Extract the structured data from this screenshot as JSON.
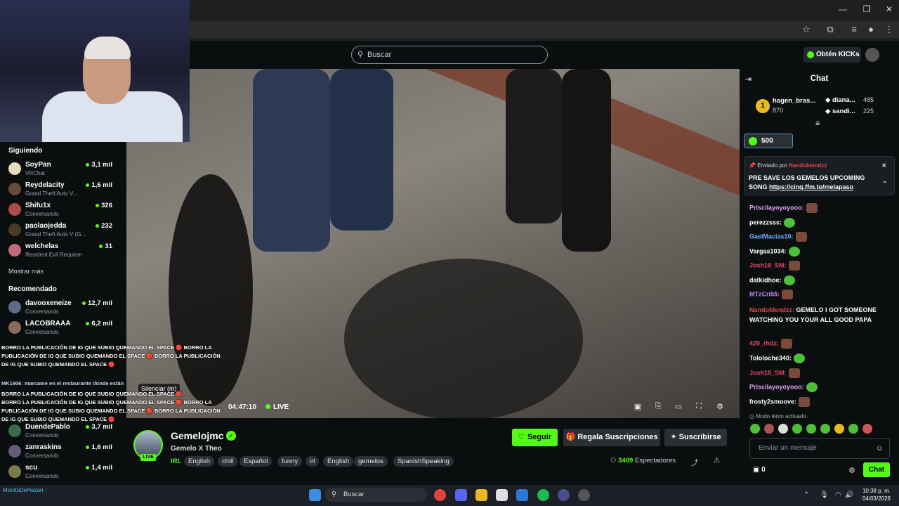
{
  "search": {
    "placeholder": "Buscar"
  },
  "header": {
    "kicks_label": "Obtén KICKs"
  },
  "sidebar": {
    "following_title": "Siguiendo",
    "following": [
      {
        "name": "SoyPan",
        "category": "VRChat",
        "viewers": "3,1 mil"
      },
      {
        "name": "Reydelacity",
        "category": "Grand Theft Auto V...",
        "viewers": "1,6 mil"
      },
      {
        "name": "Shifu1x",
        "category": "Conversando",
        "viewers": "326"
      },
      {
        "name": "paolaojedda",
        "category": "Grand Theft Auto V (G...",
        "viewers": "232"
      },
      {
        "name": "welchelas",
        "category": "Resident Evil Requiem",
        "viewers": "31"
      }
    ],
    "show_more": "Mostrar más",
    "recommended_title": "Recomendado",
    "recommended": [
      {
        "name": "davooxeneize",
        "category": "Conversando",
        "viewers": "12,7 mil"
      },
      {
        "name": "LACOBRAAA",
        "category": "Conversando",
        "viewers": "6,2 mil"
      },
      {
        "name": "DuendePablo",
        "category": "Conversando",
        "viewers": "3,7 mil"
      },
      {
        "name": "zanraskins",
        "category": "Conversando",
        "viewers": "1,6 mil"
      },
      {
        "name": "scu",
        "category": "Conversando",
        "viewers": "1,4 mil"
      }
    ]
  },
  "overlay_chat": {
    "lines": [
      "BORRO LA PUBLICACIÓN DE IG QUE SUBIO QUEMANDO EL SPACE 🔴 BORRO LA",
      "PUBLICACIÓN DE IG QUE SUBIO QUEMANDO EL SPACE 🔴 BORRO LA PUBLICACIÓN",
      "DE IG QUE SUBIO QUEMANDO EL SPACE 🔴",
      "MK1906: marcame en el restaurante donde están",
      "BORRO LA PUBLICACIÓN DE IG QUE SUBIO QUEMANDO EL SPACE 🔴",
      "BORRO LA PUBLICACIÓN DE IG QUE SUBIO QUEMANDO EL SPACE 🔴 BORRO LA",
      "PUBLICACIÓN DE IG QUE SUBIO QUEMANDO EL SPACE 🔴 BORRO LA PUBLICACIÓN",
      "DE IG QUE SUBIO QUEMANDO EL SPACE 🔴"
    ],
    "taskbar_user": "MonitoDeHazarr :"
  },
  "video": {
    "tooltip": "Silenciar (m)",
    "time": "04:47:10",
    "live": "LIVE"
  },
  "stream": {
    "streamer": "Gemelojmc",
    "live_badge": "LIVE",
    "title": "Gemelo X Theo",
    "category": "IRL",
    "tags": [
      "English",
      "chill",
      "Español",
      "funny",
      "irl",
      "English",
      "gemelos",
      "SpanishSpeaking"
    ],
    "follow": "Seguir",
    "gift": "Regala Suscripciones",
    "subscribe": "Suscribirse",
    "viewers": "3409",
    "viewers_label": "Espectadores"
  },
  "chat": {
    "title": "Chat",
    "leaderboard": [
      {
        "rank": "1",
        "name": "hagen_bras...",
        "points": "870"
      },
      {
        "name": "diana...",
        "points": "485"
      },
      {
        "name": "sandi...",
        "points": "225"
      }
    ],
    "kicks_goal": "500",
    "pinned": {
      "by_label": "Enviado por",
      "by_user": "Nandoblendzz",
      "message": "PRE SAVE LOS GEMELOS UPCOMING SONG",
      "link": "https://cinq.ffm.to/melapaso"
    },
    "messages": [
      {
        "user": "Priscilayoyoyooo:",
        "color": "#e5a3f5"
      },
      {
        "user": "perezzsss:",
        "color": "#ffffff"
      },
      {
        "user": "GaelMacias10:",
        "color": "#6fb0ff"
      },
      {
        "user": "Vargas1034:",
        "color": "#ffffff"
      },
      {
        "user": "Josh18_SM:",
        "color": "#e5486a"
      },
      {
        "user": "datkidhoe:",
        "color": "#ffffff"
      },
      {
        "user": "MTzCri55:",
        "color": "#c084fc"
      }
    ],
    "multi": {
      "user": "Nandoblendzz:",
      "text": "GEMELO I GOT SOMEONE WATCHING YOU YOUR ALL GOOD PAPA"
    },
    "messages2": [
      {
        "user": "420_rhdz:",
        "color": "#e5486a"
      },
      {
        "user": "Tololoche340:",
        "color": "#ffffff"
      },
      {
        "user": "Josh18_SM:",
        "color": "#e5486a"
      },
      {
        "user": "Priscilayoyoyooo:",
        "color": "#e5a3f5"
      },
      {
        "user": "frosty2smoove:",
        "color": "#ffffff"
      }
    ],
    "slow_mode": "Modo lento activado",
    "input_placeholder": "Enviar un mensaje",
    "footer_count": "0",
    "send": "Chat"
  },
  "taskbar": {
    "search": "Buscar",
    "time": "10:38 p. m.",
    "date": "04/03/2026"
  },
  "colors": {
    "accent": "#53fc18",
    "bg": "#0b0e0f",
    "panel": "#2c3035"
  }
}
